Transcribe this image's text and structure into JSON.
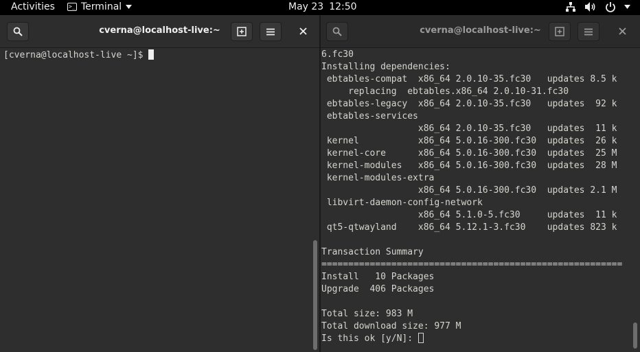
{
  "topbar": {
    "activities": "Activities",
    "app_name": "Terminal",
    "date": "May 23",
    "time": "12:50"
  },
  "left_pane": {
    "title": "cverna@localhost-live:~",
    "prompt": "[cverna@localhost-live ~]$ "
  },
  "right_pane": {
    "title": "cverna@localhost-live:~",
    "lines": [
      "6.fc30",
      "Installing dependencies:",
      " ebtables-compat  x86_64 2.0.10-35.fc30   updates 8.5 k",
      "     replacing  ebtables.x86_64 2.0.10-31.fc30",
      " ebtables-legacy  x86_64 2.0.10-35.fc30   updates  92 k",
      " ebtables-services",
      "                  x86_64 2.0.10-35.fc30   updates  11 k",
      " kernel           x86_64 5.0.16-300.fc30  updates  26 k",
      " kernel-core      x86_64 5.0.16-300.fc30  updates  25 M",
      " kernel-modules   x86_64 5.0.16-300.fc30  updates  28 M",
      " kernel-modules-extra",
      "                  x86_64 5.0.16-300.fc30  updates 2.1 M",
      " libvirt-daemon-config-network",
      "                  x86_64 5.1.0-5.fc30     updates  11 k",
      " qt5-qtwayland    x86_64 5.12.1-3.fc30    updates 823 k",
      "",
      "Transaction Summary",
      "========================================================",
      "Install   10 Packages",
      "Upgrade  406 Packages",
      "",
      "Total size: 983 M",
      "Total download size: 977 M"
    ],
    "last_prompt": "Is this ok [y/N]: "
  },
  "icons": {
    "search": "search-icon",
    "new_tab": "new-tab-icon",
    "menu": "hamburger-menu-icon",
    "close": "close-icon",
    "network": "network-icon",
    "volume": "volume-icon",
    "power": "power-icon"
  }
}
